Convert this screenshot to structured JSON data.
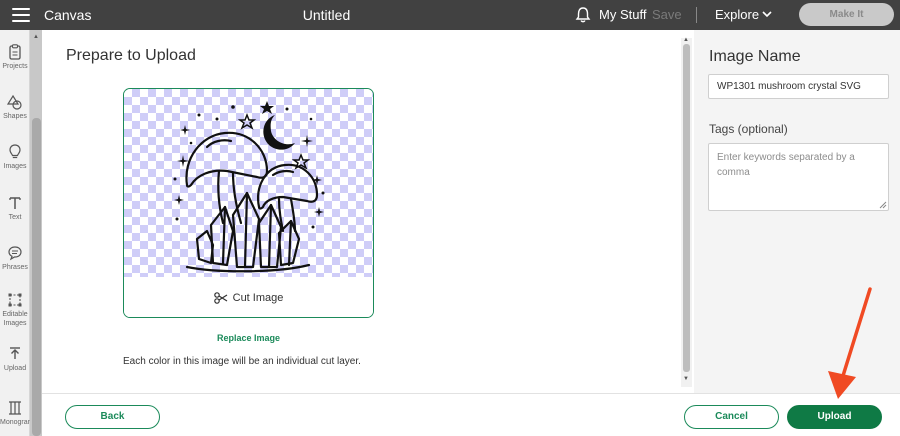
{
  "topbar": {
    "app_title": "Canvas",
    "doc_title": "Untitled",
    "my_stuff": "My Stuff",
    "save": "Save",
    "explore": "Explore",
    "make_it": "Make It"
  },
  "sidebar": {
    "items": [
      {
        "label": "Projects",
        "icon": "projects-icon"
      },
      {
        "label": "Shapes",
        "icon": "shapes-icon"
      },
      {
        "label": "Images",
        "icon": "images-icon"
      },
      {
        "label": "Text",
        "icon": "text-icon"
      },
      {
        "label": "Phrases",
        "icon": "phrases-icon"
      },
      {
        "label": "Editable Images",
        "icon": "editable-images-icon"
      },
      {
        "label": "Upload",
        "icon": "upload-icon"
      },
      {
        "label": "Monogram",
        "icon": "monogram-icon"
      }
    ]
  },
  "main": {
    "title": "Prepare to Upload",
    "cut_image": "Cut Image",
    "replace_image": "Replace Image",
    "note": "Each color in this image will be an individual cut layer."
  },
  "right_panel": {
    "image_name_label": "Image Name",
    "image_name_value": "WP1301 mushroom crystal SVG",
    "tags_label": "Tags (optional)",
    "tags_placeholder": "Enter keywords separated by a comma"
  },
  "footer": {
    "back": "Back",
    "cancel": "Cancel",
    "upload": "Upload"
  },
  "colors": {
    "accent_green": "#1b8a5a",
    "upload_green": "#0f7a45",
    "topbar": "#414141",
    "annotation_arrow": "#f04a23"
  }
}
